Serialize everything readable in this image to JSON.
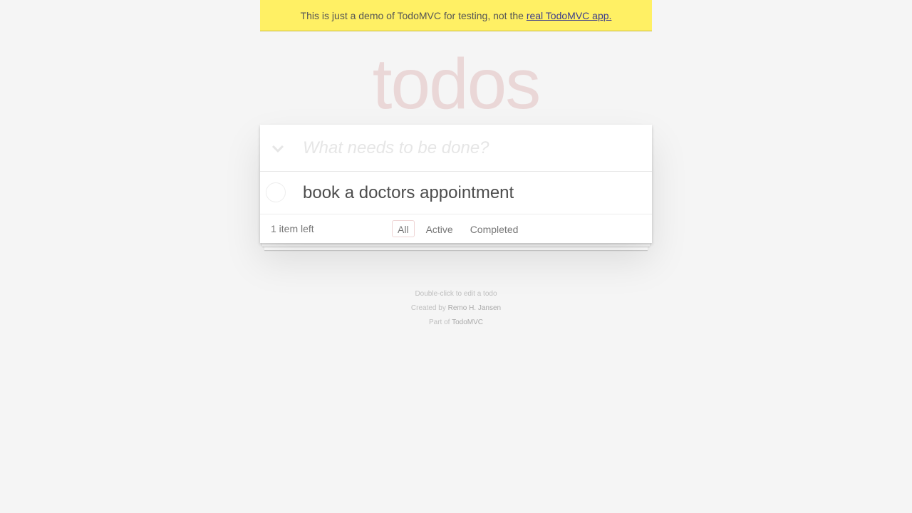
{
  "banner": {
    "text": "This is just a demo of TodoMVC for testing, not the",
    "link_text": "real TodoMVC app."
  },
  "app": {
    "title": "todos",
    "toggle_all_icon": "chevron-down-icon",
    "new_todo": {
      "placeholder": "What needs to be done?",
      "value": ""
    },
    "todos": [
      {
        "label": "book a doctors appointment",
        "completed": false
      }
    ],
    "footer": {
      "count": "1 item left",
      "filters": [
        {
          "label": "All",
          "selected": true
        },
        {
          "label": "Active",
          "selected": false
        },
        {
          "label": "Completed",
          "selected": false
        }
      ]
    }
  },
  "info": {
    "edit_hint": "Double-click to edit a todo",
    "created_prefix": "Created by",
    "created_author": "Remo H. Jansen",
    "part_prefix": "Part of",
    "part_link": "TodoMVC"
  },
  "colors": {
    "banner_bg": "#fff064",
    "title": "rgba(175,47,47,0.15)",
    "page_bg": "#f5f5f5"
  }
}
